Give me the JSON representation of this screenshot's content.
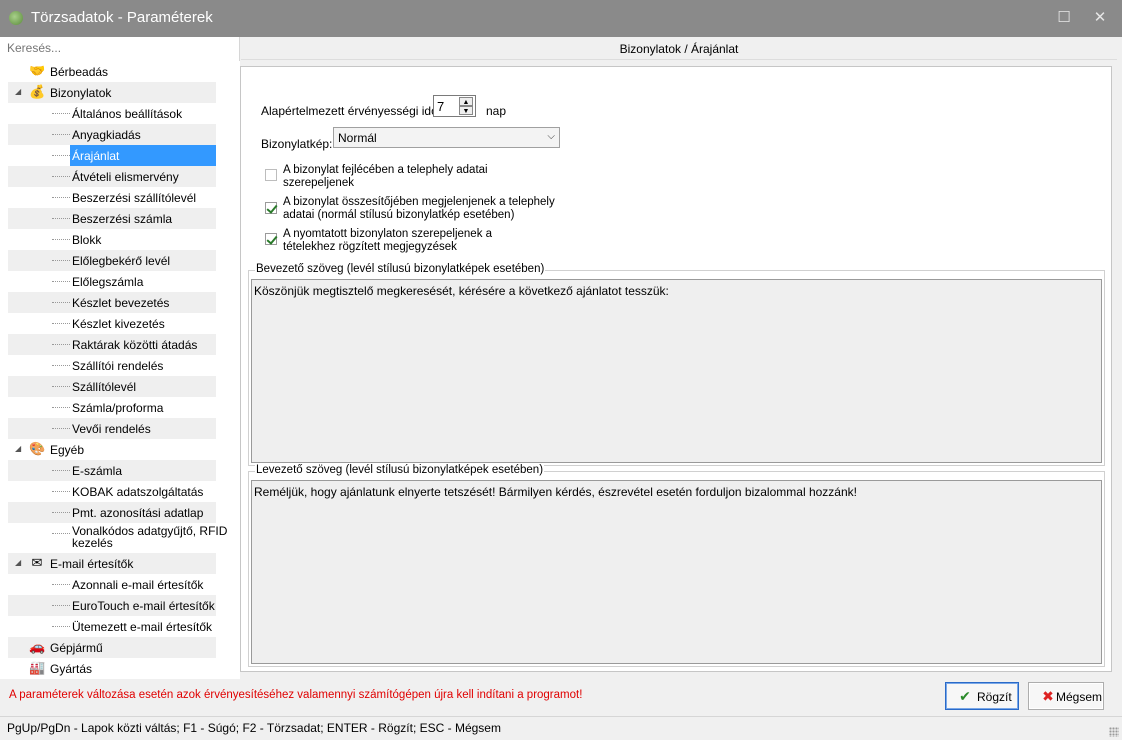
{
  "window": {
    "title": "Törzsadatok - Paraméterek"
  },
  "search": {
    "placeholder": "Keresés..."
  },
  "tree": [
    {
      "label": "Bérbeadás",
      "level": 0,
      "icon": "handshake-icon",
      "glyph": "🤝",
      "expander": ""
    },
    {
      "label": "Bizonylatok",
      "level": 0,
      "icon": "money-bag-icon",
      "glyph": "💰",
      "expander": "◢"
    },
    {
      "label": "Általános beállítások",
      "level": 1
    },
    {
      "label": "Anyagkiadás",
      "level": 1
    },
    {
      "label": "Árajánlat",
      "level": 1,
      "selected": true
    },
    {
      "label": "Átvételi elismervény",
      "level": 1
    },
    {
      "label": "Beszerzési szállítólevél",
      "level": 1
    },
    {
      "label": "Beszerzési számla",
      "level": 1
    },
    {
      "label": "Blokk",
      "level": 1
    },
    {
      "label": "Előlegbekérő levél",
      "level": 1
    },
    {
      "label": "Előlegszámla",
      "level": 1
    },
    {
      "label": "Készlet bevezetés",
      "level": 1
    },
    {
      "label": "Készlet kivezetés",
      "level": 1
    },
    {
      "label": "Raktárak közötti átadás",
      "level": 1
    },
    {
      "label": "Szállítói rendelés",
      "level": 1
    },
    {
      "label": "Szállítólevél",
      "level": 1
    },
    {
      "label": "Számla/proforma",
      "level": 1
    },
    {
      "label": "Vevői rendelés",
      "level": 1
    },
    {
      "label": "Egyéb",
      "level": 0,
      "icon": "palette-icon",
      "glyph": "🎨",
      "expander": "◢"
    },
    {
      "label": "E-számla",
      "level": 1
    },
    {
      "label": "KOBAK adatszolgáltatás",
      "level": 1
    },
    {
      "label": "Pmt. azonosítási adatlap",
      "level": 1
    },
    {
      "label": "Vonalkódos adatgyűjtő, RFID kezelés",
      "level": 1,
      "lines": [
        "Vonalkódos adatgyűjtő, RFID",
        "kezelés"
      ]
    },
    {
      "label": "E-mail értesítők",
      "level": 0,
      "icon": "envelope-icon",
      "glyph": "✉",
      "expander": "◢"
    },
    {
      "label": "Azonnali e-mail értesítők",
      "level": 1
    },
    {
      "label": "EuroTouch e-mail értesítők",
      "level": 1
    },
    {
      "label": "Ütemezett e-mail értesítők",
      "level": 1
    },
    {
      "label": "Gépjármű",
      "level": 0,
      "icon": "car-icon",
      "glyph": "🚗",
      "expander": ""
    },
    {
      "label": "Gyártás",
      "level": 0,
      "icon": "factory-icon",
      "glyph": "🏭",
      "expander": ""
    }
  ],
  "panel": {
    "header": "Bizonylatok / Árajánlat",
    "validity": {
      "label": "Alapértelmezett érvényességi idő:",
      "value": "7",
      "unit": "nap"
    },
    "doc_image": {
      "label": "Bizonylatkép:",
      "value": "Normál"
    },
    "checkboxes": [
      {
        "checked": false,
        "line1": "A bizonylat fejlécében a telephely adatai",
        "line2": "szerepeljenek"
      },
      {
        "checked": true,
        "line1": "A bizonylat összesítőjében megjelenjenek a telephely",
        "line2": "adatai (normál stílusú bizonylatkép esetében)"
      },
      {
        "checked": true,
        "line1": "A nyomtatott bizonylaton szerepeljenek a",
        "line2": "tételekhez rögzített megjegyzések"
      }
    ],
    "intro": {
      "title": "Bevezető szöveg (levél stílusú bizonylatképek esetében)",
      "text": "Köszönjük megtisztelő megkeresését, kérésére a következő ajánlatot tesszük:"
    },
    "closing": {
      "title": "Levezető szöveg (levél stílusú bizonylatképek esetében)",
      "text": "Reméljük, hogy ajánlatunk elnyerte tetszését! Bármilyen kérdés, észrevétel esetén forduljon bizalommal hozzánk!"
    }
  },
  "footer": {
    "warning": "A paraméterek változása esetén azok érvényesítéséhez valamennyi számítógépen újra kell indítani a programot!",
    "save_label": "Rögzít",
    "cancel_label": "Mégsem"
  },
  "status": {
    "text": "PgUp/PgDn - Lapok közti váltás; F1 - Súgó; F2 - Törzsadat; ENTER - Rögzít; ESC - Mégsem"
  },
  "colors": {
    "selection": "#3399ff",
    "warning": "#e00000",
    "titlebar": "#8a8a8a"
  }
}
